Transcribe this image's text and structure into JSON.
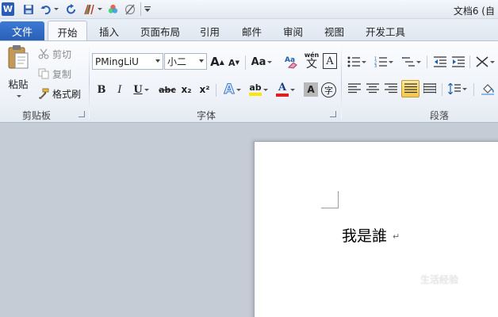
{
  "titlebar": {
    "doc_title": "文档6 (自"
  },
  "tabs": {
    "file": "文件",
    "home": "开始",
    "insert": "插入",
    "page_layout": "页面布局",
    "references": "引用",
    "mailings": "邮件",
    "review": "审阅",
    "view": "视图",
    "developer": "开发工具"
  },
  "clipboard": {
    "paste": "粘贴",
    "cut": "剪切",
    "copy": "复制",
    "format_painter": "格式刷",
    "label": "剪贴板"
  },
  "font": {
    "name": "PMingLiU",
    "size": "小二",
    "grow": "A",
    "shrink": "A",
    "change_case": "Aa",
    "pinyin_label": "wén",
    "pinyin_char": "文",
    "bold": "B",
    "italic": "I",
    "underline": "U",
    "strikethrough": "abc",
    "subscript": "x₂",
    "superscript": "x²",
    "text_effects": "A",
    "highlight": "ab",
    "font_color": "A",
    "char_shading": "A",
    "enclose": "字",
    "label": "字体"
  },
  "paragraph": {
    "label": "段落"
  },
  "document": {
    "text": "我是誰",
    "para_mark": "↵"
  },
  "watermark": "生活经验",
  "colors": {
    "file_tab": "#2a5fb5",
    "highlight_yellow": "#ffe600",
    "font_red": "#e02020",
    "justify_active": "#f7c84a"
  }
}
